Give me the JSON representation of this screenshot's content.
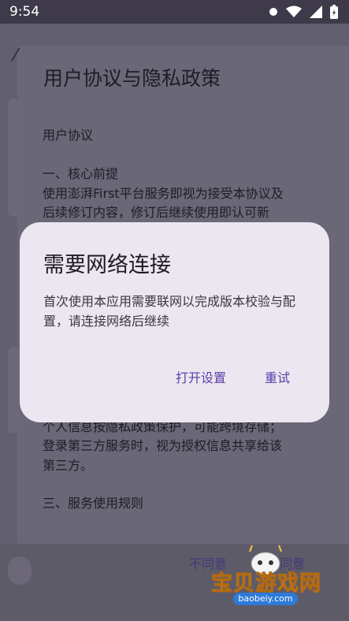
{
  "status_bar": {
    "time": "9:54"
  },
  "sheet": {
    "title": "用户协议与隐私政策",
    "lines": [
      "用户协议",
      "一、核心前提",
      "使用澎湃First平台服务即视为接受本协议及",
      "后续修订内容，修订后继续使用即认可新",
      "个人信息按隐私政策保护，可能跨境存储；",
      "登录第三方服务时，视为授权信息共享给该",
      "第三方。",
      "三、服务使用规则"
    ],
    "disagree_label": "不同意",
    "agree_label": "同意"
  },
  "dialog": {
    "title": "需要网络连接",
    "message": "首次使用本应用需要联网以完成版本校验与配置，请连接网络后继续",
    "open_settings_label": "打开设置",
    "retry_label": "重试"
  },
  "watermark": {
    "text": "宝贝游戏网",
    "url": "baobeiy.com"
  }
}
